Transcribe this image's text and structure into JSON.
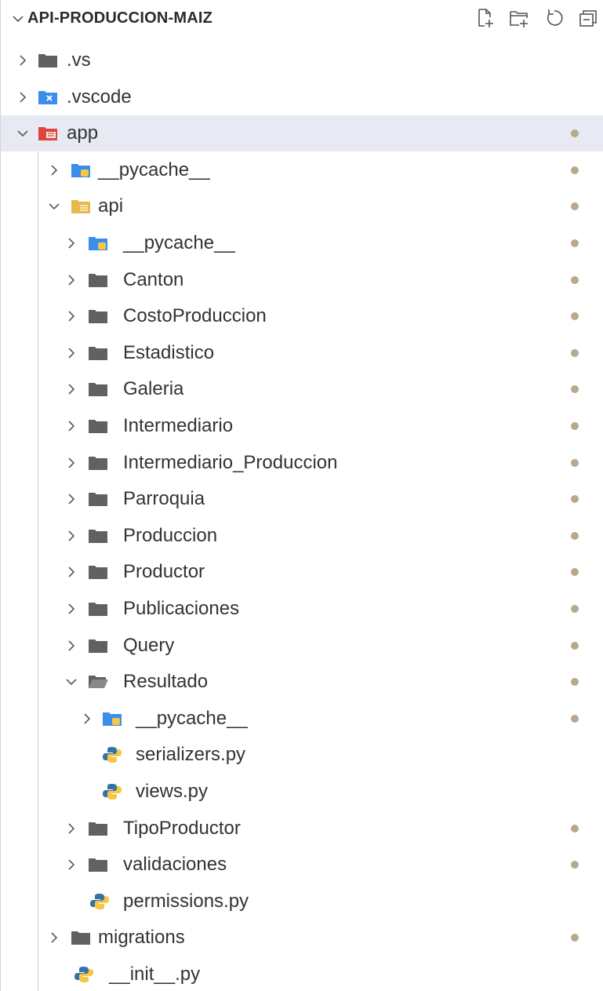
{
  "explorer": {
    "title": "API-PRODUCCION-MAIZ",
    "actions": [
      {
        "name": "new-file-icon"
      },
      {
        "name": "new-folder-icon"
      },
      {
        "name": "refresh-icon"
      },
      {
        "name": "collapse-all-icon"
      }
    ]
  },
  "colors": {
    "folder_gray": "#616161",
    "folder_vscode": "#3b8eea",
    "folder_app": "#e0443e",
    "folder_api": "#e8b84a",
    "python_blue": "#3572a5",
    "python_yellow": "#f6c744",
    "modified_dot": "#b7a989",
    "selected_bg": "#e8eaf3"
  },
  "tree": [
    {
      "label": ".vs",
      "depth": 0,
      "kind": "folder",
      "icon": "folder-icon",
      "expanded": false,
      "modified": false
    },
    {
      "label": ".vscode",
      "depth": 0,
      "kind": "folder",
      "icon": "folder-vscode-icon",
      "expanded": false,
      "modified": false
    },
    {
      "label": "app",
      "depth": 0,
      "kind": "folder",
      "icon": "folder-app-icon",
      "expanded": true,
      "modified": true,
      "selected": true
    },
    {
      "label": "__pycache__",
      "depth": 1,
      "kind": "folder",
      "icon": "folder-python-icon",
      "expanded": false,
      "modified": true
    },
    {
      "label": "api",
      "depth": 1,
      "kind": "folder",
      "icon": "folder-api-icon",
      "expanded": true,
      "modified": true
    },
    {
      "label": "__pycache__",
      "depth": 2,
      "kind": "folder",
      "icon": "folder-python-icon",
      "expanded": false,
      "modified": true
    },
    {
      "label": "Canton",
      "depth": 2,
      "kind": "folder",
      "icon": "folder-icon",
      "expanded": false,
      "modified": true
    },
    {
      "label": "CostoProduccion",
      "depth": 2,
      "kind": "folder",
      "icon": "folder-icon",
      "expanded": false,
      "modified": true
    },
    {
      "label": "Estadistico",
      "depth": 2,
      "kind": "folder",
      "icon": "folder-icon",
      "expanded": false,
      "modified": true
    },
    {
      "label": "Galeria",
      "depth": 2,
      "kind": "folder",
      "icon": "folder-icon",
      "expanded": false,
      "modified": true
    },
    {
      "label": "Intermediario",
      "depth": 2,
      "kind": "folder",
      "icon": "folder-icon",
      "expanded": false,
      "modified": true
    },
    {
      "label": "Intermediario_Produccion",
      "depth": 2,
      "kind": "folder",
      "icon": "folder-icon",
      "expanded": false,
      "modified": true
    },
    {
      "label": "Parroquia",
      "depth": 2,
      "kind": "folder",
      "icon": "folder-icon",
      "expanded": false,
      "modified": true
    },
    {
      "label": "Produccion",
      "depth": 2,
      "kind": "folder",
      "icon": "folder-icon",
      "expanded": false,
      "modified": true
    },
    {
      "label": "Productor",
      "depth": 2,
      "kind": "folder",
      "icon": "folder-icon",
      "expanded": false,
      "modified": true
    },
    {
      "label": "Publicaciones",
      "depth": 2,
      "kind": "folder",
      "icon": "folder-icon",
      "expanded": false,
      "modified": true
    },
    {
      "label": "Query",
      "depth": 2,
      "kind": "folder",
      "icon": "folder-icon",
      "expanded": false,
      "modified": true
    },
    {
      "label": "Resultado",
      "depth": 2,
      "kind": "folder",
      "icon": "folder-open-icon",
      "expanded": true,
      "modified": true
    },
    {
      "label": "__pycache__",
      "depth": 3,
      "kind": "folder",
      "icon": "folder-python-icon",
      "expanded": false,
      "modified": true
    },
    {
      "label": "serializers.py",
      "depth": 3,
      "kind": "file",
      "icon": "python-file-icon",
      "modified": false
    },
    {
      "label": "views.py",
      "depth": 3,
      "kind": "file",
      "icon": "python-file-icon",
      "modified": false
    },
    {
      "label": "TipoProductor",
      "depth": 2,
      "kind": "folder",
      "icon": "folder-icon",
      "expanded": false,
      "modified": true
    },
    {
      "label": "validaciones",
      "depth": 2,
      "kind": "folder",
      "icon": "folder-icon",
      "expanded": false,
      "modified": true
    },
    {
      "label": "permissions.py",
      "depth": 2,
      "kind": "file",
      "icon": "python-file-icon",
      "modified": false
    },
    {
      "label": "migrations",
      "depth": 1,
      "kind": "folder",
      "icon": "folder-icon",
      "expanded": false,
      "modified": true
    },
    {
      "label": "__init__.py",
      "depth": 1,
      "kind": "file",
      "icon": "python-file-icon",
      "modified": false
    }
  ]
}
